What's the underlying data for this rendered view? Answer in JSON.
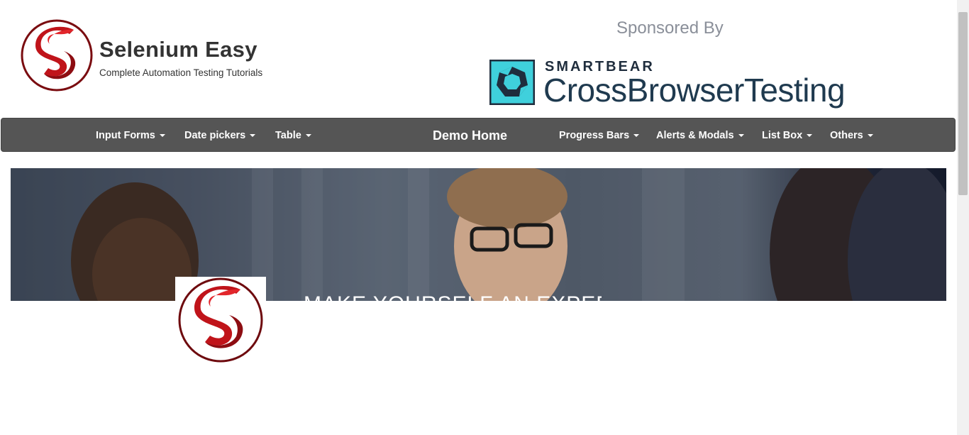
{
  "header": {
    "brand_title": "Selenium Easy",
    "brand_tagline": "Complete Automation Testing Tutorials",
    "sponsored_label": "Sponsored By",
    "sponsor_company": "SMARTBEAR",
    "sponsor_product": "CrossBrowserTesting"
  },
  "navbar": {
    "items": [
      {
        "label": "Input Forms",
        "has_dropdown": true
      },
      {
        "label": "Date pickers",
        "has_dropdown": true
      },
      {
        "label": "Table",
        "has_dropdown": true
      },
      {
        "label": "Demo Home",
        "has_dropdown": false
      },
      {
        "label": "Progress Bars",
        "has_dropdown": true
      },
      {
        "label": "Alerts & Modals",
        "has_dropdown": true
      },
      {
        "label": "List Box",
        "has_dropdown": true
      },
      {
        "label": "Others",
        "has_dropdown": true
      }
    ]
  },
  "hero": {
    "headline": "MAKE YOURSELF AN EXPERT"
  },
  "colors": {
    "navbar_bg": "#555555",
    "brand_red": "#c0141a",
    "sponsor_teal": "#3fd0dc",
    "sponsor_navy": "#1f2d3d"
  },
  "icons": {
    "brand_logo": "selenium-easy-logo",
    "sponsor_logo": "crossbrowsertesting-logo",
    "dropdown": "caret-down-icon"
  }
}
